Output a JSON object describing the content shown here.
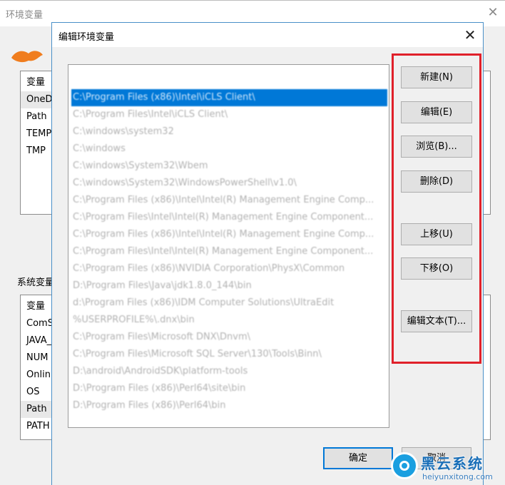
{
  "background_window": {
    "title": "环境变量",
    "close_glyph": "✕",
    "user_vars": {
      "header": "变量",
      "rows": [
        "OneD",
        "Path",
        "TEMP",
        "TMP"
      ]
    },
    "system_section_label": "系统变量",
    "system_vars": {
      "header": "变量",
      "rows": [
        "ComS",
        "JAVA_",
        "NUM",
        "Onlin",
        "OS",
        "Path",
        "PATH"
      ]
    }
  },
  "dialog": {
    "title": "编辑环境变量",
    "close_glyph": "✕",
    "path_entries": [
      "C:\\Program Files (x86)\\Intel\\iCLS Client\\",
      "C:\\Program Files\\Intel\\iCLS Client\\",
      "C:\\windows\\system32",
      "C:\\windows",
      "C:\\windows\\System32\\Wbem",
      "C:\\windows\\System32\\WindowsPowerShell\\v1.0\\",
      "C:\\Program Files (x86)\\Intel\\Intel(R) Management Engine Comp...",
      "C:\\Program Files\\Intel\\Intel(R) Management Engine Component...",
      "C:\\Program Files (x86)\\Intel\\Intel(R) Management Engine Comp...",
      "C:\\Program Files\\Intel\\Intel(R) Management Engine Component...",
      "C:\\Program Files (x86)\\NVIDIA Corporation\\PhysX\\Common",
      "D:\\Program Files\\Java\\jdk1.8.0_144\\bin",
      "d:\\Program Files (x86)\\IDM Computer Solutions\\UltraEdit",
      "%USERPROFILE%\\.dnx\\bin",
      "C:\\Program Files\\Microsoft DNX\\Dnvm\\",
      "C:\\Program Files\\Microsoft SQL Server\\130\\Tools\\Binn\\",
      "D:\\android\\AndroidSDK\\platform-tools",
      "D:\\Program Files (x86)\\Perl64\\site\\bin",
      "D:\\Program Files (x86)\\Perl64\\bin"
    ],
    "buttons": {
      "new": "新建(N)",
      "edit": "编辑(E)",
      "browse": "浏览(B)...",
      "delete": "删除(D)",
      "move_up": "上移(U)",
      "move_down": "下移(O)",
      "edit_text": "编辑文本(T)...",
      "ok": "确定",
      "cancel": "取消"
    }
  },
  "watermark": {
    "name": "黑云系统",
    "url": "heiyunxitong.com"
  },
  "colors": {
    "selection": "#0078d7",
    "highlight_box": "#e0202a",
    "dialog_border": "#4a90c8"
  }
}
